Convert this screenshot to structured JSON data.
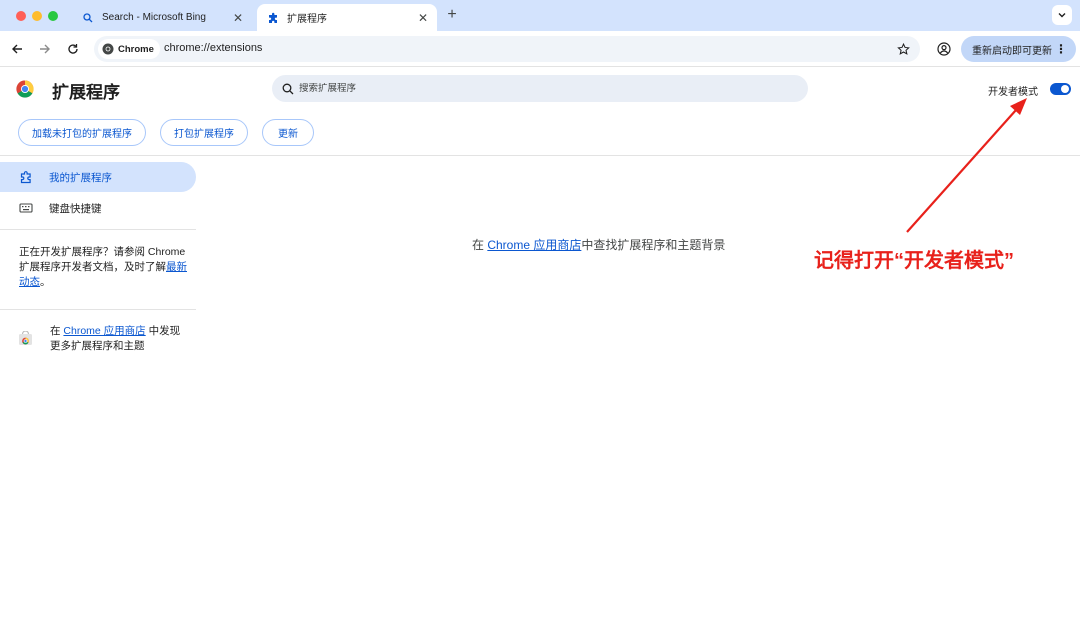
{
  "tabs": [
    {
      "title": "Search - Microsoft Bing",
      "icon": "search-icon",
      "active": false
    },
    {
      "title": "扩展程序",
      "icon": "puzzle-icon",
      "active": true
    }
  ],
  "toolbar": {
    "chip_label": "Chrome",
    "url": "chrome://extensions",
    "update_label": "重新启动即可更新"
  },
  "header": {
    "title": "扩展程序",
    "search_placeholder": "搜索扩展程序",
    "dev_mode_label": "开发者模式",
    "dev_mode_on": true
  },
  "actions": {
    "load_unpacked": "加载未打包的扩展程序",
    "pack": "打包扩展程序",
    "update": "更新"
  },
  "sidebar": {
    "items": [
      {
        "label": "我的扩展程序",
        "icon": "puzzle-outline-icon",
        "selected": true
      },
      {
        "label": "键盘快捷键",
        "icon": "keyboard-icon",
        "selected": false
      }
    ],
    "dev_note_prefix": "正在开发扩展程序？请参阅 Chrome 扩展程序开发者文档，及时了解",
    "dev_note_link": "最新动态",
    "dev_note_suffix": "。",
    "store_prefix": "在 ",
    "store_link": "Chrome 应用商店",
    "store_suffix": " 中发现更多扩展程序和主题"
  },
  "main": {
    "empty_prefix": "在 ",
    "empty_link": "Chrome 应用商店",
    "empty_suffix": "中查找扩展程序和主题背景"
  },
  "annotation": {
    "text": "记得打开“开发者模式”",
    "color": "#e8211b"
  },
  "colors": {
    "accent": "#0b57d0",
    "tabstrip": "#d3e3fd",
    "sidebar_selected": "#d3e3fd"
  }
}
